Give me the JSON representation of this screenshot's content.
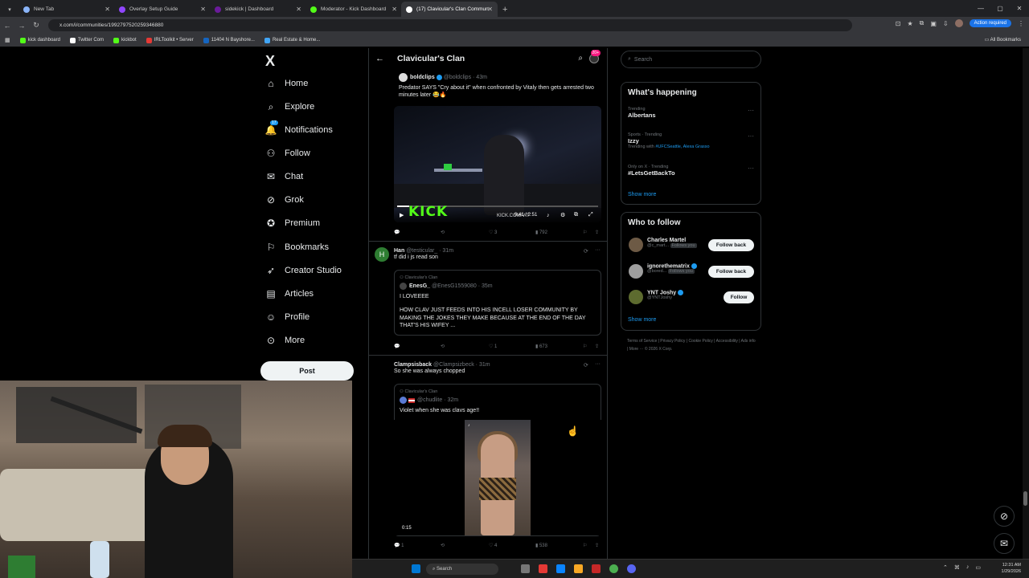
{
  "browser": {
    "tabs": [
      {
        "label": "New Tab",
        "active": false,
        "color": "#8ab4f8"
      },
      {
        "label": "Overlay Setup Guide",
        "active": false,
        "color": "#9146ff"
      },
      {
        "label": "sidekick | Dashboard",
        "active": false,
        "color": "#6a1b9a"
      },
      {
        "label": "Moderator - Kick Dashboard",
        "active": false,
        "color": "#53fc18"
      },
      {
        "label": "(17) Clavicular's Clan Commun",
        "active": true,
        "color": "#ffffff"
      }
    ],
    "url": "x.com/i/communities/1992797520259346880",
    "action_required": "Action required",
    "bookmarks": [
      "kick dashboard",
      "Twitter Com",
      "kickbot",
      "IRLToolkit • Server",
      "11404 N Bayshore...",
      "Real Estate & Home..."
    ],
    "all_bookmarks": "All Bookmarks"
  },
  "nav": {
    "logo": "X",
    "notif_count": "17",
    "items": [
      "Home",
      "Explore",
      "Notifications",
      "Follow",
      "Chat",
      "Grok",
      "Premium",
      "Bookmarks",
      "Creator Studio",
      "Articles",
      "Profile",
      "More"
    ],
    "post_label": "Post"
  },
  "community": {
    "title": "Clavicular's Clan",
    "badge": "20+"
  },
  "tweet1": {
    "name": "boldclips",
    "handle": "@boldclips · 43m",
    "text": "Predator SAYS \"Cry about it\" when confronted by Vitaly then gets arrested two minutes later 😂🔥",
    "video_logo": "KICK",
    "video_watermark": "KICK.COM/VIT",
    "video_time": "0:41 / 2:51",
    "likes": "3",
    "views": "792"
  },
  "tweet2": {
    "avatar_letter": "H",
    "name": "Han",
    "handle": "@testicular_ · 31m",
    "text": "tf did i js read son",
    "quote_community": "Clavicular's Clan",
    "quote_name": "EnesG_",
    "quote_handle": "@EnesG1559080 · 35m",
    "quote_line1": "I LOVEEEE",
    "quote_line2": "HOW CLAV JUST FEEDS INTO HIS INCELL LOSER COMMUNITY BY MAKING THE JOKES THEY MAKE BECAUSE AT THE END OF THE DAY THAT'S HIS WIFEY ...",
    "likes": "1",
    "views": "673"
  },
  "tweet3": {
    "name": "Clampsisback",
    "handle": "@Clampsizbeck · 31m",
    "text": "So she was always chopped",
    "quote_community": "Clavicular's Clan",
    "quote_handle": "@chudlite · 32m",
    "quote_text": "Violet when she was clavs age!!",
    "video_time": "0:15",
    "replies": "1",
    "likes": "4",
    "views": "538"
  },
  "sidebar": {
    "search_placeholder": "Search",
    "happening_title": "What's happening",
    "trends": [
      {
        "meta": "Trending",
        "name": "Albertans",
        "extra_prefix": "",
        "extra_link": ""
      },
      {
        "meta": "Sports · Trending",
        "name": "Izzy",
        "extra_prefix": "Trending with",
        "extra_link": "#UFCSeattle, Alexa Grasso"
      },
      {
        "meta": "Only on X · Trending",
        "name": "#LetsGetBackTo",
        "extra_prefix": "",
        "extra_link": ""
      }
    ],
    "show_more": "Show more",
    "who_title": "Who to follow",
    "follow": [
      {
        "name": "Charles Martel",
        "handle": "@c_mart...",
        "tag": "Follows you",
        "button": "Follow back",
        "verified": false
      },
      {
        "name": "ignorethematrix",
        "handle": "@bored...",
        "tag": "Follows you",
        "button": "Follow back",
        "verified": true
      },
      {
        "name": "YNT Joshy",
        "handle": "@YNTJoshy",
        "tag": "",
        "button": "Follow",
        "verified": true
      }
    ],
    "footer": "Terms of Service | Privacy Policy | Cookie Policy | Accessibility | Ads info | More ··· © 2026 X Corp."
  },
  "taskbar": {
    "search": "Search",
    "time": "12:31 AM",
    "date": "1/29/2026"
  }
}
